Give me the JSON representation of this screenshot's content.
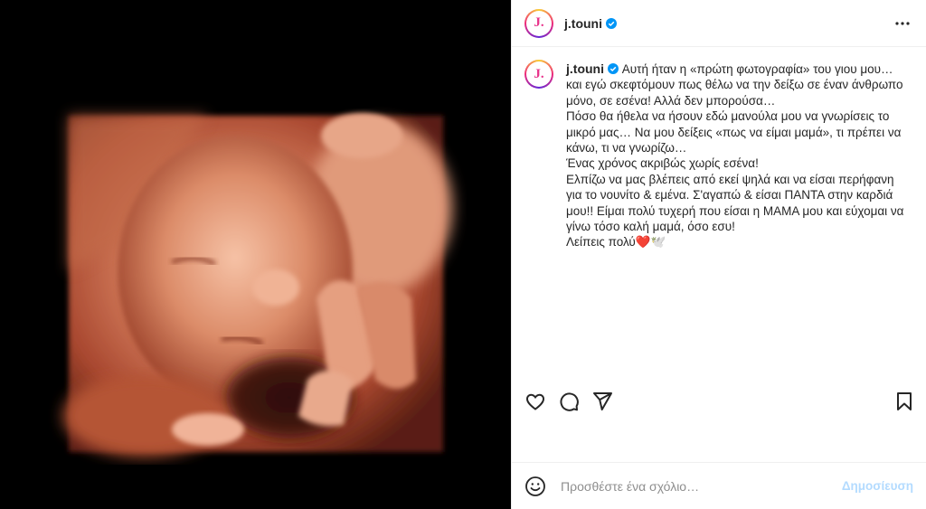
{
  "header": {
    "avatar_letter": "J.",
    "username": "j.touni"
  },
  "caption": {
    "avatar_letter": "J.",
    "username": "j.touni",
    "first_line": " Αυτή ήταν η «πρώτη φωτογραφία» του γιου μου…",
    "lines": [
      "και εγώ σκεφτόμουν πως θέλω να την δείξω σε έναν άνθρωπο",
      "μόνο, σε εσένα! Αλλά δεν μπορούσα…",
      "Πόσο θα ήθελα να ήσουν εδώ μανούλα μου να γνωρίσεις το",
      "μικρό μας… Να μου δείξεις «πως να είμαι μαμά», τι πρέπει να",
      "κάνω, τι να γνωρίζω…",
      "Ένας χρόνος ακριβώς χωρίς εσένα!",
      "",
      "Ελπίζω να μας βλέπεις από εκεί ψηλά και να είσαι περήφανη",
      "για το νουνίτο & εμένα. Σ'αγαπώ & είσαι ΠΑΝΤΑ στην καρδιά",
      "μου!! Είμαι πολύ τυχερή που είσαι η ΜΑΜΑ μου και εύχομαι να",
      "γίνω τόσο καλή μαμά, όσο εσυ!",
      ""
    ],
    "last_line_text": "Λείπεις πολύ",
    "last_line_emoji": "❤️🕊️"
  },
  "actions": {
    "icons": [
      "heart-icon",
      "comment-icon",
      "share-icon",
      "bookmark-icon"
    ]
  },
  "comment_bar": {
    "placeholder": "Προσθέστε ένα σχόλιο…",
    "post_label": "Δημοσίευση"
  },
  "colors": {
    "verified": "#0095f6",
    "post_button_disabled": "#b3dbff",
    "avatar_letter": "#e8338b"
  }
}
